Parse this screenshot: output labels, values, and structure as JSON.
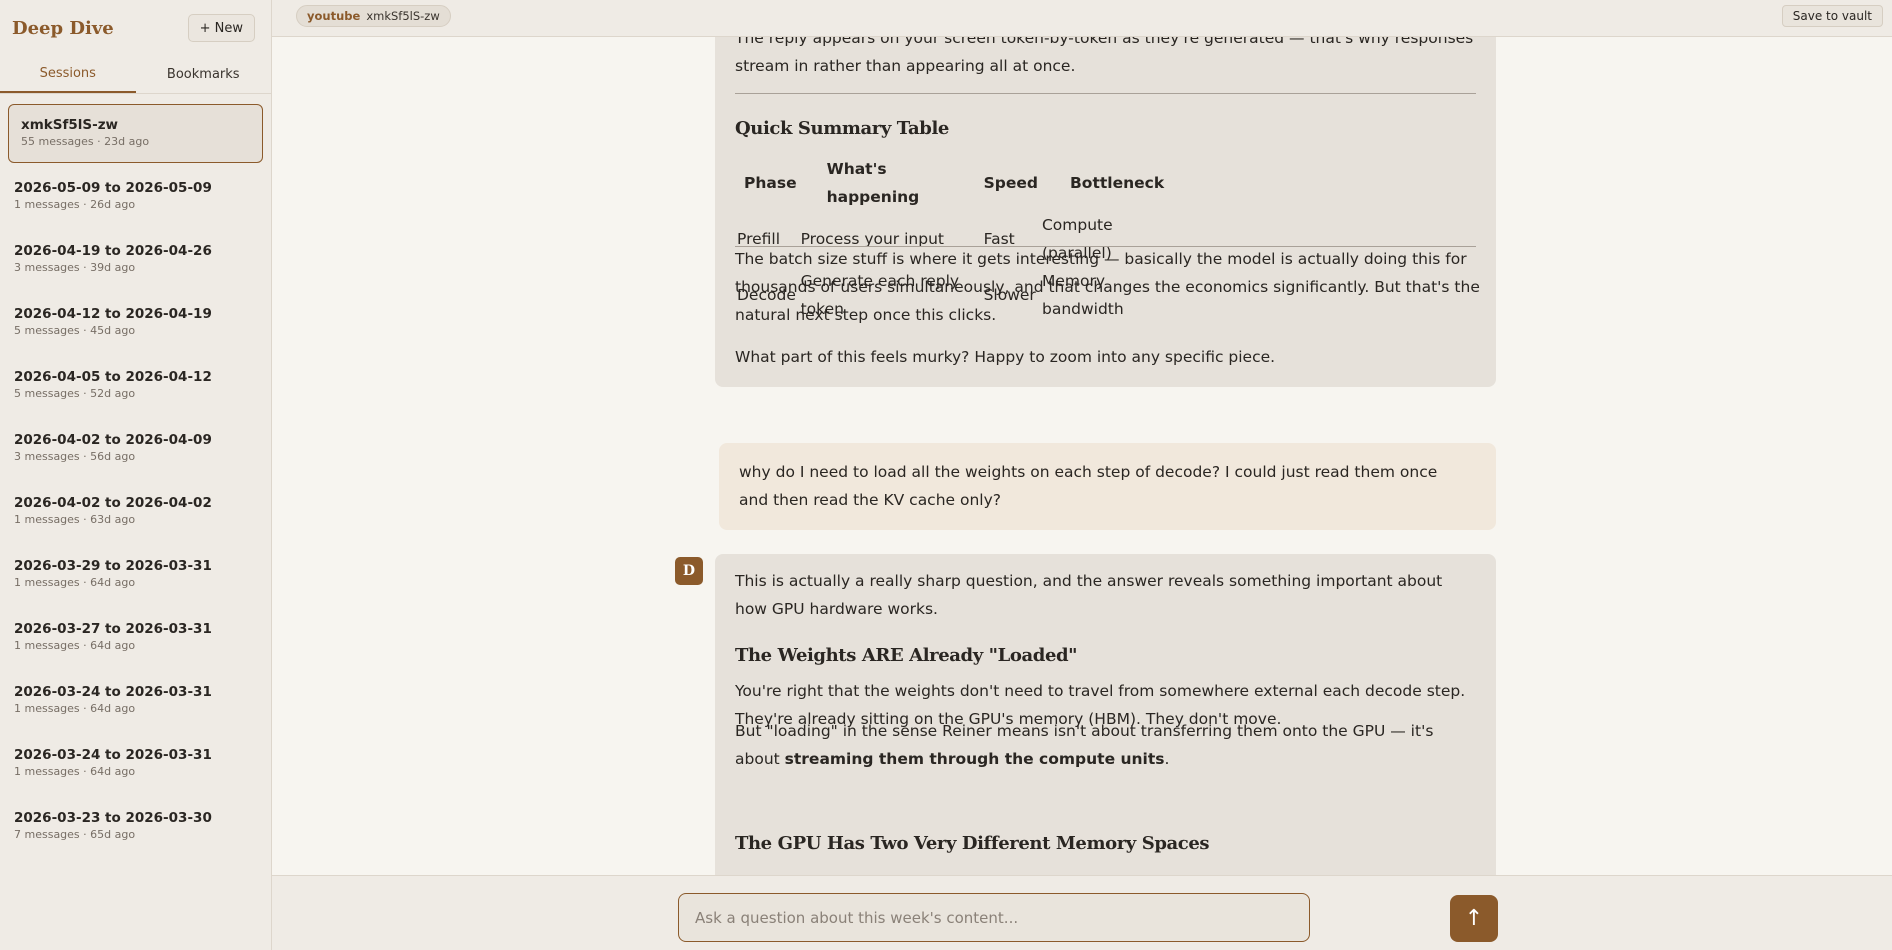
{
  "app": {
    "title": "Deep Dive",
    "new_label": "+ New"
  },
  "sidebar": {
    "tabs": [
      {
        "label": "Sessions"
      },
      {
        "label": "Bookmarks"
      }
    ],
    "sessions": [
      {
        "title": "xmkSf5lS-zw",
        "meta": "55 messages · 23d ago"
      },
      {
        "title": "2026-05-09 to 2026-05-09",
        "meta": "1 messages · 26d ago"
      },
      {
        "title": "2026-04-19 to 2026-04-26",
        "meta": "3 messages · 39d ago"
      },
      {
        "title": "2026-04-12 to 2026-04-19",
        "meta": "5 messages · 45d ago"
      },
      {
        "title": "2026-04-05 to 2026-04-12",
        "meta": "5 messages · 52d ago"
      },
      {
        "title": "2026-04-02 to 2026-04-09",
        "meta": "3 messages · 56d ago"
      },
      {
        "title": "2026-04-02 to 2026-04-02",
        "meta": "1 messages · 63d ago"
      },
      {
        "title": "2026-03-29 to 2026-03-31",
        "meta": "1 messages · 64d ago"
      },
      {
        "title": "2026-03-27 to 2026-03-31",
        "meta": "1 messages · 64d ago"
      },
      {
        "title": "2026-03-24 to 2026-03-31",
        "meta": "1 messages · 64d ago"
      },
      {
        "title": "2026-03-24 to 2026-03-31",
        "meta": "1 messages · 64d ago"
      },
      {
        "title": "2026-03-23 to 2026-03-30",
        "meta": "7 messages · 65d ago"
      }
    ]
  },
  "topbar": {
    "source_kind": "youtube",
    "source_id": "xmkSf5lS-zw",
    "save_label": "Save to vault"
  },
  "chat": {
    "msg1": {
      "intro": "The reply appears on your screen token-by-token as they're generated — that's why responses stream in rather than appearing all at once.",
      "table_heading": "Quick Summary Table",
      "table_headers": [
        "Phase",
        "What's happening",
        "Speed",
        "Bottleneck"
      ],
      "table_rows": [
        [
          "Prefill",
          "Process your input",
          "Fast",
          "Compute (parallel)"
        ],
        [
          "Decode",
          "Generate each reply token",
          "Slower",
          "Memory bandwidth"
        ]
      ],
      "para1": "The batch size stuff is where it gets interesting — basically the model is actually doing this for thousands of users simultaneously, and that changes the economics significantly. But that's the natural next step once this clicks.",
      "para2": "What part of this feels murky? Happy to zoom into any specific piece."
    },
    "user_msg": "why do I need to load all the weights on each step of decode? I could just read them once and then read the KV cache only?",
    "avatar_letter": "D",
    "msg2": {
      "intro": "This is actually a really sharp question, and the answer reveals something important about how GPU hardware works.",
      "heading1": "The Weights ARE Already \"Loaded\"",
      "para1": "You're right that the weights don't need to travel from somewhere external each decode step. They're already sitting on the GPU's memory (HBM). They don't move.",
      "para2_pre": "But \"loading\" in the sense Reiner means isn't about transferring them onto the GPU — it's about ",
      "para2_bold": "streaming them through the compute units",
      "para2_post": ".",
      "heading2": "The GPU Has Two Very Different Memory Spaces"
    }
  },
  "composer": {
    "placeholder": "Ask a question about this week's content...",
    "send_icon": "↑"
  },
  "colors": {
    "accent": "#8b5a2b",
    "sidebar_bg": "#efebe5",
    "assistant_bubble": "#e6e1da",
    "user_bubble": "#f1e8dc"
  }
}
